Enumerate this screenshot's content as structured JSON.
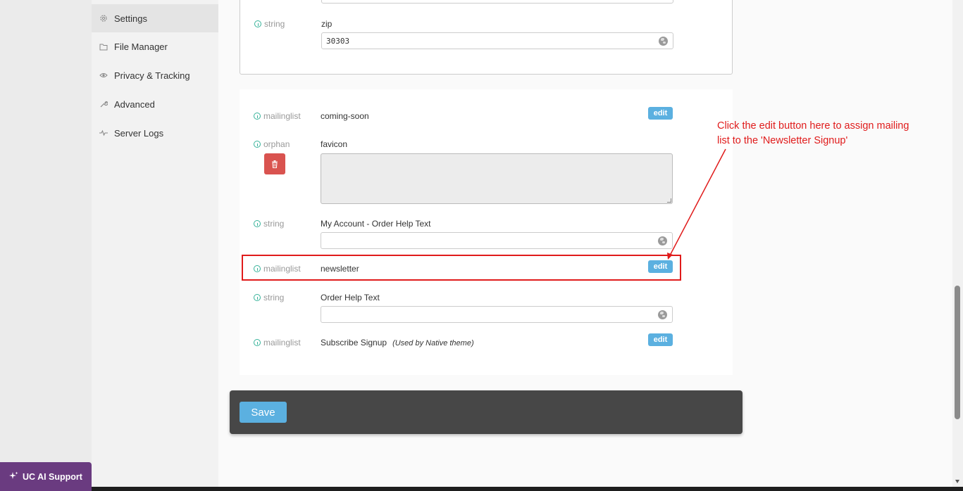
{
  "sidebar": {
    "items": [
      {
        "label": "Settings",
        "icon": "gear-icon"
      },
      {
        "label": "File Manager",
        "icon": "folder-icon"
      },
      {
        "label": "Privacy & Tracking",
        "icon": "eye-icon"
      },
      {
        "label": "Advanced",
        "icon": "wrench-icon"
      },
      {
        "label": "Server Logs",
        "icon": "pulse-icon"
      }
    ]
  },
  "top_panel": {
    "zip": {
      "type": "string",
      "label": "zip",
      "value": "30303"
    }
  },
  "fields": [
    {
      "type": "mailinglist",
      "label": "coming-soon",
      "action": "edit"
    },
    {
      "type": "orphan",
      "label": "favicon",
      "value": ""
    },
    {
      "type": "string",
      "label": "My Account - Order Help Text",
      "value": ""
    },
    {
      "type": "mailinglist",
      "label": "newsletter",
      "action": "edit"
    },
    {
      "type": "string",
      "label": "Order Help Text",
      "value": ""
    },
    {
      "type": "mailinglist",
      "label": "Subscribe Signup",
      "note": "(Used by Native theme)",
      "action": "edit"
    }
  ],
  "annotation": {
    "text": "Click the edit button here to assign mailing list to the 'Newsletter Signup'",
    "color": "#e01b1b"
  },
  "save_bar": {
    "save_label": "Save"
  },
  "ai_support": {
    "label": "UC AI Support"
  },
  "colors": {
    "accent": "#5bb0e0",
    "danger": "#d9534f",
    "type_icon": "#37b39a",
    "ai_support_bg": "#6a3b80"
  }
}
